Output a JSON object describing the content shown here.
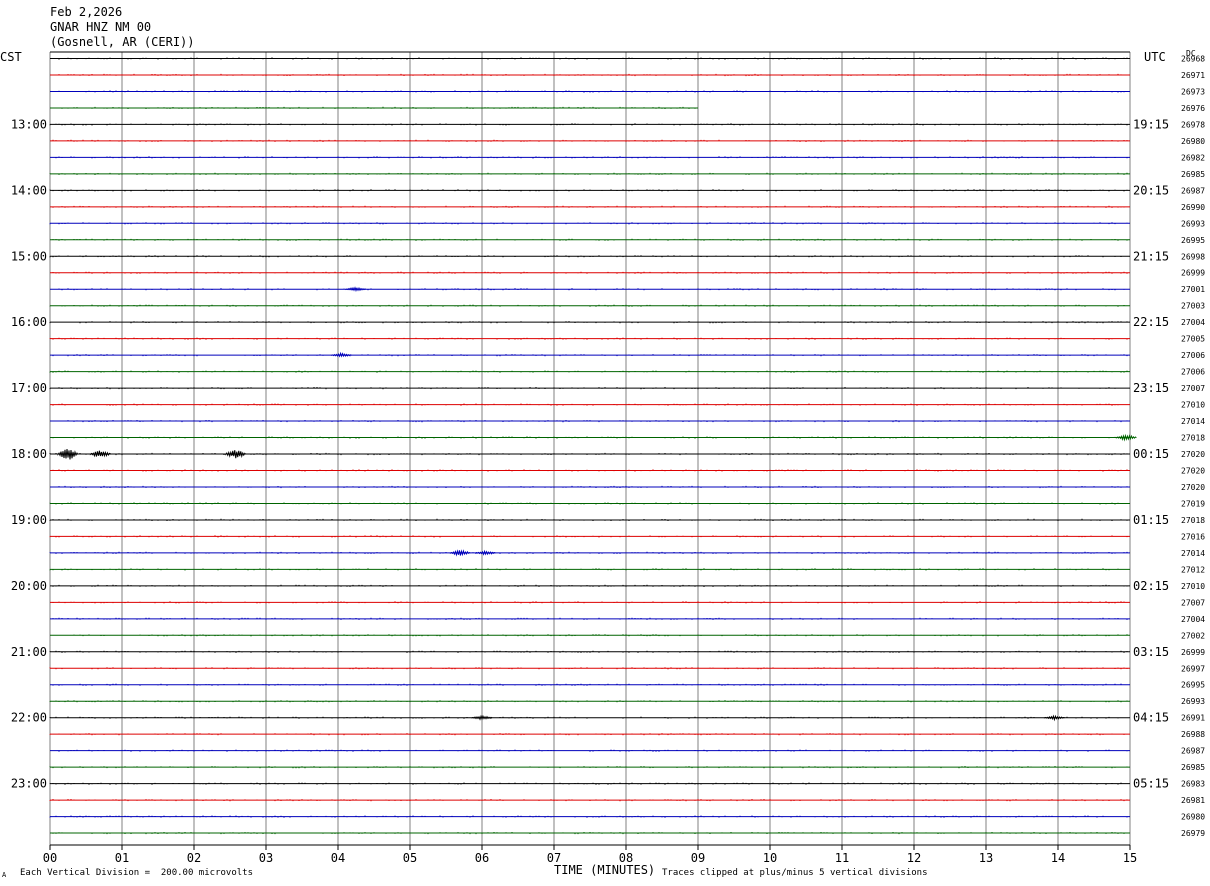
{
  "header": {
    "date": "Feb 2,2026",
    "station": "GNAR HNZ NM 00",
    "location": "(Gosnell, AR (CERI))"
  },
  "left_corner_label": "CST",
  "right_corner_label": "UTC",
  "dc_header": "DC",
  "footer": {
    "left_mark": "A",
    "scale_note": "Each Vertical Division =  200.00 microvolts",
    "x_title": "TIME (MINUTES)",
    "clip_note": "Traces clipped at plus/minus 5 vertical divisions"
  },
  "colors": {
    "trace_cycle": [
      "#000000",
      "#dd0000",
      "#0000bb",
      "#006400"
    ],
    "grid": "#808080"
  },
  "chart_data": {
    "type": "line",
    "title": "Feb 2,2026  GNAR HNZ NM 00  (Gosnell, AR (CERI))",
    "xlabel": "TIME (MINUTES)",
    "xlim": [
      0,
      15
    ],
    "x_ticks": [
      "00",
      "01",
      "02",
      "03",
      "04",
      "05",
      "06",
      "07",
      "08",
      "09",
      "10",
      "11",
      "12",
      "13",
      "14",
      "15"
    ],
    "left_time_labels": [
      "13:00",
      "14:00",
      "15:00",
      "16:00",
      "17:00",
      "18:00",
      "19:00",
      "20:00",
      "21:00",
      "22:00",
      "23:00"
    ],
    "right_time_labels": [
      "19:15",
      "20:15",
      "21:15",
      "22:15",
      "23:15",
      "00:15",
      "01:15",
      "02:15",
      "03:15",
      "04:15",
      "05:15"
    ],
    "labeled_row_start": 4,
    "labeled_row_step": 4,
    "dc_offsets": [
      26968,
      26971,
      26973,
      26976,
      26978,
      26980,
      26982,
      26985,
      26987,
      26990,
      26993,
      26995,
      26998,
      26999,
      27001,
      27003,
      27004,
      27005,
      27006,
      27006,
      27007,
      27010,
      27014,
      27018,
      27020,
      27020,
      27020,
      27019,
      27018,
      27016,
      27014,
      27012,
      27010,
      27007,
      27004,
      27002,
      26999,
      26997,
      26995,
      26993,
      26991,
      26988,
      26987,
      26985,
      26983,
      26981,
      26980,
      26979
    ],
    "trace_partial_end_minutes": {
      "3": 9.0
    },
    "events": [
      {
        "row": 24,
        "minute": 0.25,
        "amp": 7
      },
      {
        "row": 24,
        "minute": 0.7,
        "amp": 4
      },
      {
        "row": 24,
        "minute": 2.58,
        "amp": 5
      },
      {
        "row": 30,
        "minute": 5.7,
        "amp": 3
      },
      {
        "row": 30,
        "minute": 6.05,
        "amp": 2
      },
      {
        "row": 14,
        "minute": 4.25,
        "amp": 2
      },
      {
        "row": 18,
        "minute": 4.05,
        "amp": 2
      },
      {
        "row": 23,
        "minute": 14.95,
        "amp": 3
      },
      {
        "row": 40,
        "minute": 6.0,
        "amp": 2
      },
      {
        "row": 40,
        "minute": 13.95,
        "amp": 2
      }
    ],
    "grid": true
  }
}
